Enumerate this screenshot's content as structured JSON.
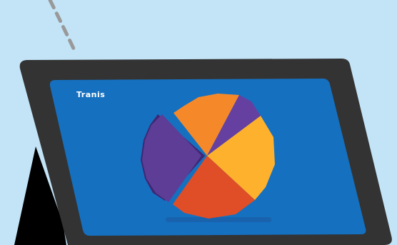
{
  "scene": {
    "screen_label": "Tranis",
    "colors": {
      "background": "#c3e4f7",
      "device_frame": "#333333",
      "screen": "#1570c0",
      "cable": "#999999",
      "slice_purple": "#5d3d96",
      "slice_orange": "#f5892a",
      "slice_violet": "#6540a0",
      "slice_yellow": "#fdb12d",
      "slice_red": "#df4e27"
    }
  }
}
